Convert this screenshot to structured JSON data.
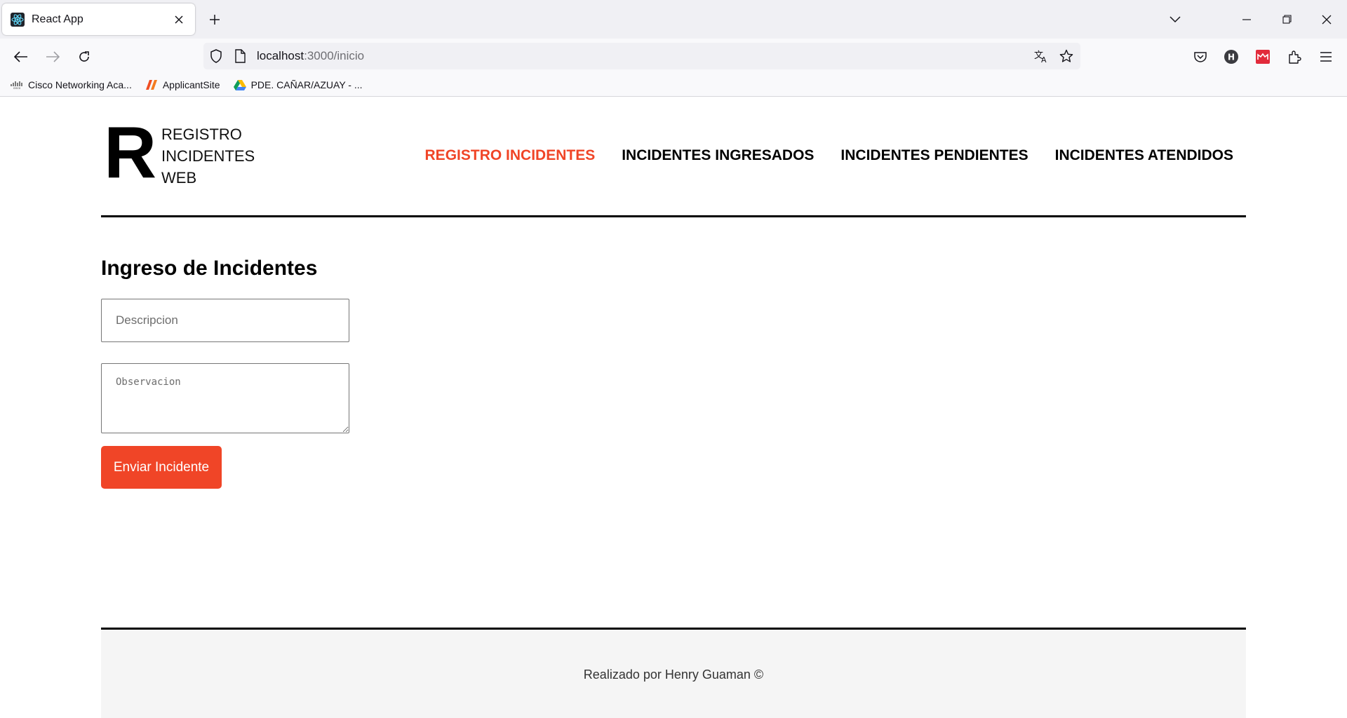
{
  "browser": {
    "tab": {
      "title": "React App",
      "favicon": "react-icon"
    },
    "url": {
      "host": "localhost",
      "path": ":3000/inicio"
    },
    "bookmarks": [
      {
        "label": "Cisco Networking Aca...",
        "icon": "cisco-icon"
      },
      {
        "label": "ApplicantSite",
        "icon": "applicantsite-icon"
      },
      {
        "label": "PDE. CAÑAR/AZUAY - ...",
        "icon": "google-drive-icon"
      }
    ]
  },
  "header": {
    "logo_letter": "R",
    "logo_lines": [
      "REGISTRO",
      "INCIDENTES",
      "WEB"
    ],
    "nav": [
      {
        "label": "REGISTRO INCIDENTES",
        "active": true
      },
      {
        "label": "INCIDENTES INGRESADOS",
        "active": false
      },
      {
        "label": "INCIDENTES PENDIENTES",
        "active": false
      },
      {
        "label": "INCIDENTES ATENDIDOS",
        "active": false
      }
    ]
  },
  "form": {
    "title": "Ingreso de Incidentes",
    "description": {
      "value": "",
      "placeholder": "Descripcion"
    },
    "observation": {
      "value": "",
      "placeholder": "Observacion"
    },
    "submit_label": "Enviar Incidente"
  },
  "footer": {
    "text": "Realizado por Henry Guaman ©"
  },
  "colors": {
    "accent": "#f04527",
    "text": "#000000",
    "footer_bg": "#f5f5f5"
  }
}
